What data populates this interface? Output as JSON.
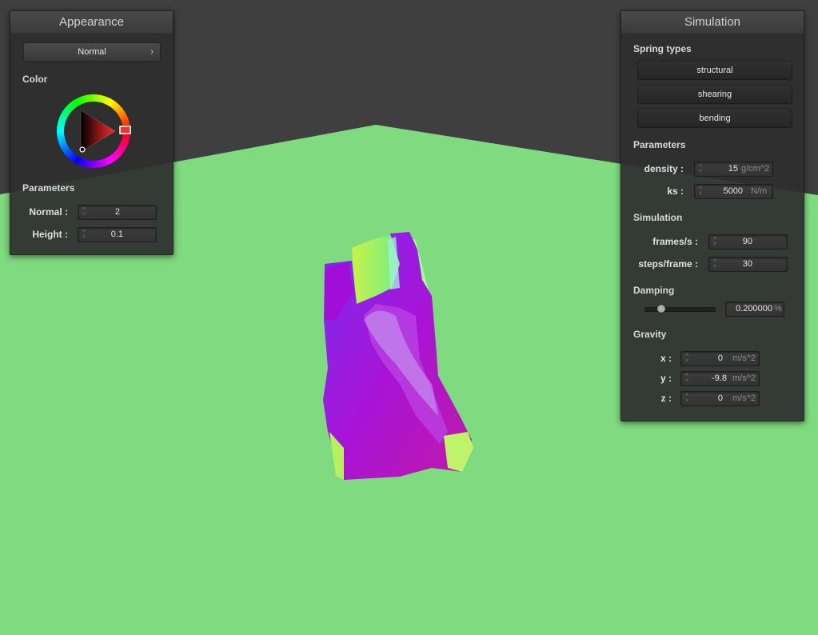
{
  "colors": {
    "sky": "#3f3f3f",
    "ground": "#7fda80",
    "panel_bg": "#2e2e2e",
    "cloth_primary": "#9b1be0",
    "cloth_secondary": "#a8f050"
  },
  "appearance": {
    "title": "Appearance",
    "shader_select": "Normal",
    "color_label": "Color",
    "parameters_label": "Parameters",
    "normal_label": "Normal :",
    "normal_value": "2",
    "height_label": "Height :",
    "height_value": "0.1"
  },
  "simulation": {
    "title": "Simulation",
    "spring_types_label": "Spring types",
    "spring_buttons": [
      "structural",
      "shearing",
      "bending"
    ],
    "parameters_label": "Parameters",
    "density_label": "density :",
    "density_value": "15",
    "density_unit": "g/cm^2",
    "ks_label": "ks :",
    "ks_value": "5000",
    "ks_unit": "N/m",
    "simulation_label": "Simulation",
    "fps_label": "frames/s :",
    "fps_value": "90",
    "steps_label": "steps/frame :",
    "steps_value": "30",
    "damping_label": "Damping",
    "damping_value": "0.200000",
    "damping_unit": "%",
    "damping_level": 0.2,
    "gravity_label": "Gravity",
    "gx_label": "x :",
    "gx_value": "0",
    "gy_label": "y :",
    "gy_value": "-9.8",
    "gz_label": "z :",
    "gz_value": "0",
    "gravity_unit": "m/s^2"
  }
}
